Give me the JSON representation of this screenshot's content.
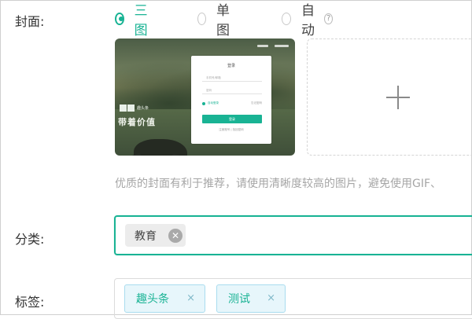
{
  "labels": {
    "cover": "封面:",
    "category": "分类:",
    "tags": "标签:"
  },
  "cover_mode": {
    "options": [
      {
        "label": "三图",
        "checked": true
      },
      {
        "label": "单图",
        "checked": false
      },
      {
        "label": "自动",
        "checked": false
      }
    ],
    "help_icon": "?"
  },
  "thumbnail": {
    "slogan": "带着价值",
    "logo_text": "趣头条",
    "login": {
      "title": "登录",
      "username_placeholder": "手机号/邮箱",
      "password_placeholder": "密码",
      "remember": "自动登录",
      "forgot": "忘记密码",
      "submit": "登录",
      "footer": "注册账号 | 找回密码"
    }
  },
  "add_button_icon": "plus-icon",
  "hint": "优质的封面有利于推荐，请使用清晰度较高的图片，避免使用GIF、",
  "category": {
    "selected": "教育",
    "remove_icon": "✕"
  },
  "tags": {
    "items": [
      {
        "label": "趣头条"
      },
      {
        "label": "测试"
      }
    ],
    "remove_icon": "×"
  },
  "colors": {
    "accent": "#19b394",
    "tag_bg": "#e7f6fb"
  }
}
